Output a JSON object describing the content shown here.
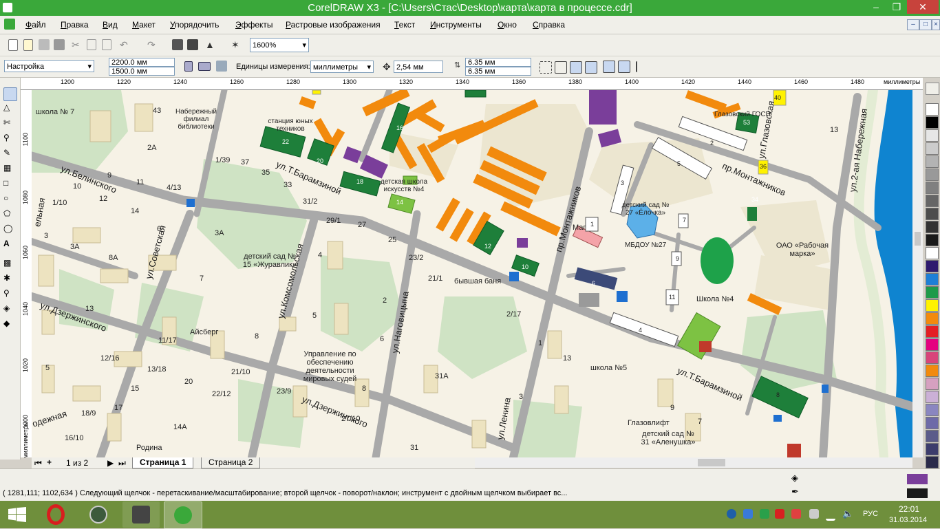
{
  "window": {
    "title": "CorelDRAW X3 - [C:\\Users\\Стас\\Desktop\\карта\\карта в процессе.cdr]",
    "controls": {
      "minimize": "–",
      "restore": "❐",
      "close": "✕"
    }
  },
  "menu": {
    "items": [
      "Файл",
      "Правка",
      "Вид",
      "Макет",
      "Упорядочить",
      "Эффекты",
      "Растровые изображения",
      "Текст",
      "Инструменты",
      "Окно",
      "Справка"
    ]
  },
  "toolbar1": {
    "zoom": "1600%"
  },
  "toolbar2": {
    "preset": "Настройка",
    "page_width": "2200.0 мм",
    "page_height": "1500.0 мм",
    "units_label": "Единицы измерения:",
    "units_value": "миллиметры",
    "nudge": "2,54 мм",
    "dup_x": "6.35 мм",
    "dup_y": "6.35 мм"
  },
  "rulers": {
    "h_ticks": [
      "1200",
      "1220",
      "1240",
      "1260",
      "1280",
      "1300",
      "1320",
      "1340",
      "1360",
      "1380",
      "1400",
      "1420",
      "1440",
      "1460",
      "1480"
    ],
    "h_unit": "миллиметры",
    "v_ticks": [
      "1100",
      "1080",
      "1060",
      "1040",
      "1020",
      "1000"
    ],
    "v_unit": "миллиметры"
  },
  "map": {
    "streets": [
      "ул.Т.Барамзиной",
      "ул.Белинского",
      "ул.Советская",
      "ул.Комсомольская",
      "ул.Наговицына",
      "ул.Дзержинского",
      "ул.Дзержинского",
      "пр.Монтажников",
      "пр.Монтажников",
      "ул.Глазовская",
      "ул.2-ая Набережная",
      "ул.Т.Барамзиной",
      "ул.Ленина",
      "одежная",
      "ельная"
    ],
    "labels": [
      "школа № 7",
      "Набережный филиал библиотеки",
      "станция юных техников",
      "детская школа искусств №4",
      "детский сад № 15 «Журавлик»",
      "Айсберг",
      "Управление по обеспечению деятельности мировых судей",
      "бывшая баня",
      "детский сад № 27 «Ёлочка»",
      "МБДОУ №27",
      "Маг",
      "ОАО «Рабочая марка»",
      "Школа №4",
      "школа №5",
      "Глазовлифт",
      "детский сад № 31 «Аленушка»",
      "Родина",
      "Глазовский ГОСП",
      "43",
      "2А",
      "1/39",
      "37",
      "35",
      "33",
      "4/13",
      "9",
      "11",
      "10",
      "12",
      "14",
      "1/10",
      "3",
      "3А",
      "8А",
      "6",
      "3А",
      "31/2",
      "29/1",
      "27",
      "25",
      "23/2",
      "21/1",
      "2/17",
      "8",
      "11/17",
      "7",
      "5",
      "4",
      "13",
      "12/16",
      "13/18",
      "20",
      "22/12",
      "21/10",
      "23/9",
      "27/10",
      "31",
      "6",
      "31А",
      "2",
      "5",
      "8",
      "1",
      "13",
      "3",
      "16",
      "22",
      "20",
      "18",
      "14",
      "12",
      "10",
      "1",
      "7",
      "9",
      "11",
      "3",
      "5",
      "2",
      "8",
      "6",
      "4",
      "53",
      "36",
      "34",
      "40",
      "13",
      "7",
      "9",
      "18/9",
      "16/10",
      "14А",
      "17",
      "15"
    ]
  },
  "pages": {
    "counter": "1 из 2",
    "tabs": [
      "Страница 1",
      "Страница 2"
    ]
  },
  "status": {
    "message": "( 1281,111; 1102,634 ) Следующий щелчок - перетаскивание/масштабирование; второй щелчок - поворот/наклон; инструмент с двойным щелчком выбирает вс..."
  },
  "colors": {
    "titlebar": "#3aa83a",
    "taskbar": "#6f8f3c",
    "building_orange": "#f28a0d",
    "building_green": "#1e7f3a",
    "building_purple": "#7a3e9a",
    "fill_swatch": "#7a3e9a",
    "outline_swatch": "#1a1a1a"
  },
  "palette": [
    "#ffffff",
    "#000000",
    "#e6e6e6",
    "#cccccc",
    "#b3b3b3",
    "#999999",
    "#808080",
    "#666666",
    "#4d4d4d",
    "#333333",
    "#1a1a1a",
    "#ffffff",
    "#2e1a6e",
    "#1e7fd6",
    "#1e9a4a",
    "#fff200",
    "#f28a0d",
    "#e31e24",
    "#e4007f",
    "#d8457a",
    "#f28a0d",
    "#d6a0c0",
    "#cbb0d6",
    "#8a86c0",
    "#6e6aa8",
    "#5b5b8a",
    "#3c3c6c",
    "#2a2a4a"
  ],
  "taskbar": {
    "lang": "РУС",
    "time": "22:01",
    "date": "31.03.2014"
  }
}
